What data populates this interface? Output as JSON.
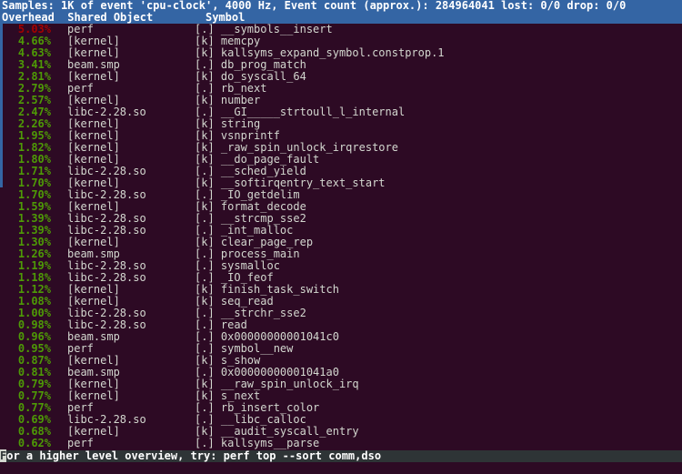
{
  "header": {
    "line1": "Samples: 1K of event 'cpu-clock', 4000 Hz, Event count (approx.): 284964041 lost: 0/0 drop: 0/0",
    "samples": "1K",
    "event": "cpu-clock",
    "frequency": "4000 Hz",
    "event_count": "284964041",
    "lost": "0/0",
    "drop": "0/0",
    "columns": {
      "overhead": "Overhead",
      "shared_object": "Shared Object",
      "symbol": "Symbol"
    },
    "columns_line": "Overhead  Shared Object        Symbol"
  },
  "colors": {
    "header_bg": "#3465a4",
    "header_fg": "#ffffff",
    "body_bg": "#2d0a24",
    "body_fg": "#d3d7cf",
    "pct_normal": "#4e9a06",
    "pct_top": "#a40000",
    "status_bg": "#2e3436",
    "status_fg": "#ffffff",
    "scrollbar": "#3465a4"
  },
  "rows": [
    {
      "pct": "5.03%",
      "dso": "perf",
      "sym": "[.] __symbols__insert"
    },
    {
      "pct": "4.66%",
      "dso": "[kernel]",
      "sym": "[k] memcpy"
    },
    {
      "pct": "4.63%",
      "dso": "[kernel]",
      "sym": "[k] kallsyms_expand_symbol.constprop.1"
    },
    {
      "pct": "3.41%",
      "dso": "beam.smp",
      "sym": "[.] db_prog_match"
    },
    {
      "pct": "2.81%",
      "dso": "[kernel]",
      "sym": "[k] do_syscall_64"
    },
    {
      "pct": "2.79%",
      "dso": "perf",
      "sym": "[.] rb_next"
    },
    {
      "pct": "2.57%",
      "dso": "[kernel]",
      "sym": "[k] number"
    },
    {
      "pct": "2.47%",
      "dso": "libc-2.28.so",
      "sym": "[.] __GI_____strtoull_l_internal"
    },
    {
      "pct": "2.26%",
      "dso": "[kernel]",
      "sym": "[k] string"
    },
    {
      "pct": "1.95%",
      "dso": "[kernel]",
      "sym": "[k] vsnprintf"
    },
    {
      "pct": "1.82%",
      "dso": "[kernel]",
      "sym": "[k] _raw_spin_unlock_irqrestore"
    },
    {
      "pct": "1.80%",
      "dso": "[kernel]",
      "sym": "[k] __do_page_fault"
    },
    {
      "pct": "1.71%",
      "dso": "libc-2.28.so",
      "sym": "[.] __sched_yield"
    },
    {
      "pct": "1.70%",
      "dso": "[kernel]",
      "sym": "[k] __softirqentry_text_start"
    },
    {
      "pct": "1.70%",
      "dso": "libc-2.28.so",
      "sym": "[.] _IO_getdelim"
    },
    {
      "pct": "1.59%",
      "dso": "[kernel]",
      "sym": "[k] format_decode"
    },
    {
      "pct": "1.39%",
      "dso": "libc-2.28.so",
      "sym": "[.] __strcmp_sse2"
    },
    {
      "pct": "1.39%",
      "dso": "libc-2.28.so",
      "sym": "[.] _int_malloc"
    },
    {
      "pct": "1.30%",
      "dso": "[kernel]",
      "sym": "[k] clear_page_rep"
    },
    {
      "pct": "1.26%",
      "dso": "beam.smp",
      "sym": "[.] process_main"
    },
    {
      "pct": "1.19%",
      "dso": "libc-2.28.so",
      "sym": "[.] sysmalloc"
    },
    {
      "pct": "1.18%",
      "dso": "libc-2.28.so",
      "sym": "[.] _IO_feof"
    },
    {
      "pct": "1.12%",
      "dso": "[kernel]",
      "sym": "[k] finish_task_switch"
    },
    {
      "pct": "1.08%",
      "dso": "[kernel]",
      "sym": "[k] seq_read"
    },
    {
      "pct": "1.00%",
      "dso": "libc-2.28.so",
      "sym": "[.] __strchr_sse2"
    },
    {
      "pct": "0.98%",
      "dso": "libc-2.28.so",
      "sym": "[.] read"
    },
    {
      "pct": "0.96%",
      "dso": "beam.smp",
      "sym": "[.] 0x00000000001041c0"
    },
    {
      "pct": "0.95%",
      "dso": "perf",
      "sym": "[.] symbol__new"
    },
    {
      "pct": "0.87%",
      "dso": "[kernel]",
      "sym": "[k] s_show"
    },
    {
      "pct": "0.81%",
      "dso": "beam.smp",
      "sym": "[.] 0x00000000001041a0"
    },
    {
      "pct": "0.79%",
      "dso": "[kernel]",
      "sym": "[k] __raw_spin_unlock_irq"
    },
    {
      "pct": "0.77%",
      "dso": "[kernel]",
      "sym": "[k] s_next"
    },
    {
      "pct": "0.77%",
      "dso": "perf",
      "sym": "[.] rb_insert_color"
    },
    {
      "pct": "0.69%",
      "dso": "libc-2.28.so",
      "sym": "[.] __libc_calloc"
    },
    {
      "pct": "0.68%",
      "dso": "[kernel]",
      "sym": "[k] __audit_syscall_entry"
    },
    {
      "pct": "0.62%",
      "dso": "perf",
      "sym": "[.] kallsyms__parse"
    }
  ],
  "status": {
    "cursor_char": "F",
    "text": "or a higher level overview, try: perf top --sort comm,dso",
    "full_text": "For a higher level overview, try: perf top --sort comm,dso"
  }
}
